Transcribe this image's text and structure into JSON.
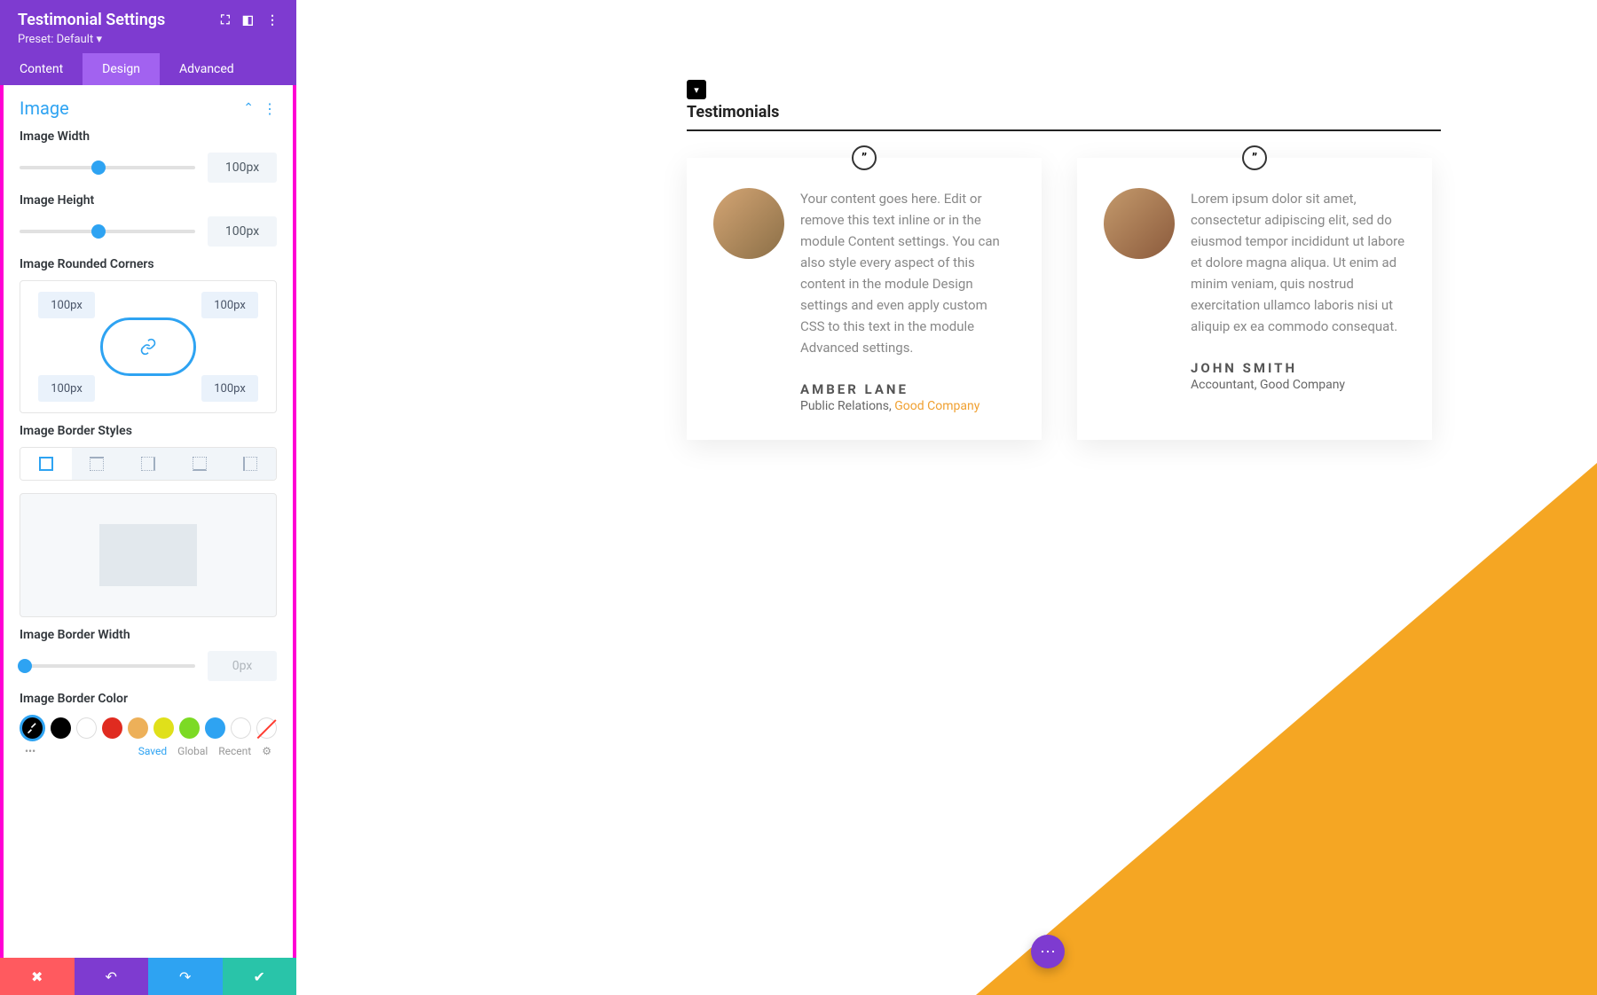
{
  "panel": {
    "title": "Testimonial Settings",
    "preset": "Preset: Default",
    "tabs": [
      "Content",
      "Design",
      "Advanced"
    ],
    "active_tab": 1,
    "section_title": "Image",
    "fields": {
      "width_label": "Image Width",
      "width_value": "100px",
      "height_label": "Image Height",
      "height_value": "100px",
      "corners_label": "Image Rounded Corners",
      "corners": {
        "tl": "100px",
        "tr": "100px",
        "bl": "100px",
        "br": "100px"
      },
      "border_styles_label": "Image Border Styles",
      "border_width_label": "Image Border Width",
      "border_width_value": "0px",
      "border_color_label": "Image Border Color"
    },
    "colors": [
      "#000000",
      "#ffffff",
      "#e02b20",
      "#edb059",
      "#e0e01a",
      "#7cda24",
      "#2ea3f2",
      "#ffffff"
    ],
    "footer_tabs": {
      "saved": "Saved",
      "global": "Global",
      "recent": "Recent"
    }
  },
  "canvas": {
    "section_title": "Testimonials",
    "quote_glyph": "”",
    "cards": [
      {
        "text": "Your content goes here. Edit or remove this text inline or in the module Content settings. You can also style every aspect of this content in the module Design settings and even apply custom CSS to this text in the module Advanced settings.",
        "author": "AMBER LANE",
        "role_prefix": "Public Relations, ",
        "company": "Good Company",
        "company_link": true
      },
      {
        "text": "Lorem ipsum dolor sit amet, consectetur adipiscing elit, sed do eiusmod tempor incididunt ut labore et dolore magna aliqua. Ut enim ad minim veniam, quis nostrud exercitation ullamco laboris nisi ut aliquip ex ea commodo consequat.",
        "author": "JOHN SMITH",
        "role_prefix": "Accountant, ",
        "company": "Good Company",
        "company_link": false
      }
    ]
  }
}
